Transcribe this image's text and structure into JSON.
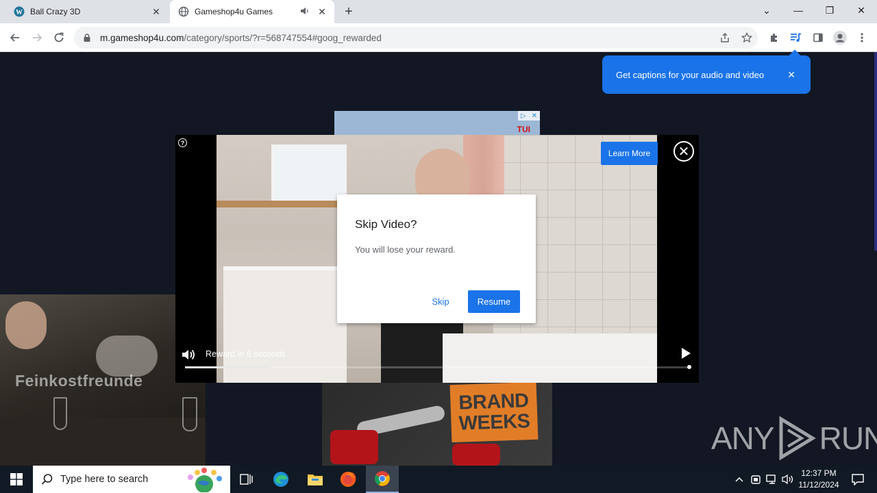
{
  "browser": {
    "tabs": [
      {
        "title": "Ball Crazy 3D",
        "close": "✕"
      },
      {
        "title": "Gameshop4u Games",
        "close": "✕"
      }
    ],
    "new_tab": "+",
    "window_controls": {
      "list": "⌄",
      "minimize": "—",
      "restore": "❐",
      "close": "✕"
    },
    "url_host": "m.gameshop4u.com",
    "url_path": "/category/sports/?r=568747554#goog_rewarded"
  },
  "captions_popup": {
    "text": "Get captions for your audio and video",
    "close": "✕"
  },
  "page": {
    "ad_left_brand": "Feinkostfreunde",
    "ad_top_brand": "TUI",
    "ad_bottom_line1": "BRAND",
    "ad_bottom_line2": "WEEKS",
    "watermark_left": "ANY",
    "watermark_right": "RUN"
  },
  "video_ad": {
    "help": "?",
    "learn_more": "Learn More",
    "close": "✕",
    "reward_text": "Reward in 6 seconds",
    "progress_fraction": 0.17
  },
  "dialog": {
    "title": "Skip Video?",
    "message": "You will lose your reward.",
    "skip": "Skip",
    "resume": "Resume"
  },
  "taskbar": {
    "search_placeholder": "Type here to search",
    "time": "12:37 PM",
    "date": "11/12/2024"
  },
  "colors": {
    "accent": "#1a73e8",
    "page_bg": "#121723",
    "taskbar_bg": "#111a24"
  }
}
